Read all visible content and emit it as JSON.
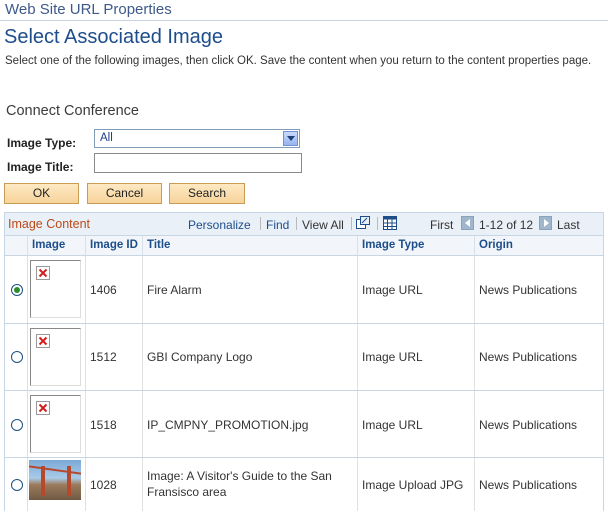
{
  "window_title": "Web Site URL Properties",
  "page_title": "Select Associated Image",
  "instructions": "Select one of the following images, then click OK.  Save the content when you return to the content properties page.",
  "section_title": "Connect Conference",
  "form": {
    "image_type_label": "Image Type:",
    "image_type_value": "All",
    "image_title_label": "Image Title:",
    "image_title_value": ""
  },
  "buttons": {
    "ok": "OK",
    "cancel": "Cancel",
    "search": "Search"
  },
  "grid": {
    "title": "Image Content",
    "personalize": "Personalize",
    "find": "Find",
    "view_all": "View All",
    "first": "First",
    "range": "1-12 of 12",
    "last": "Last",
    "columns": [
      "Image",
      "Image ID",
      "Title",
      "Image Type",
      "Origin"
    ],
    "rows": [
      {
        "selected": true,
        "image": "broken-image-icon",
        "id": "1406",
        "title_lines": [
          "Fire Alarm"
        ],
        "type": "Image URL",
        "origin": "News Publications"
      },
      {
        "selected": false,
        "image": "broken-image-icon",
        "id": "1512",
        "title_lines": [
          "GBI Company Logo"
        ],
        "type": "Image URL",
        "origin": "News Publications"
      },
      {
        "selected": false,
        "image": "broken-image-icon",
        "id": "1518",
        "title_lines": [
          "IP_CMPNY_PROMOTION.jpg"
        ],
        "type": "Image URL",
        "origin": "News Publications"
      },
      {
        "selected": false,
        "image": "golden-gate-bridge-photo",
        "id": "1028",
        "title_lines": [
          "Image: A Visitor's Guide to the San",
          "Fransisco area"
        ],
        "type": "Image Upload JPG",
        "origin": "News Publications"
      }
    ]
  },
  "colors": {
    "accent": "#1d4d8b",
    "grid_title": "#bb4a17",
    "button_bg": "#f7d39a",
    "selected_radio": "#2e8b2e"
  }
}
